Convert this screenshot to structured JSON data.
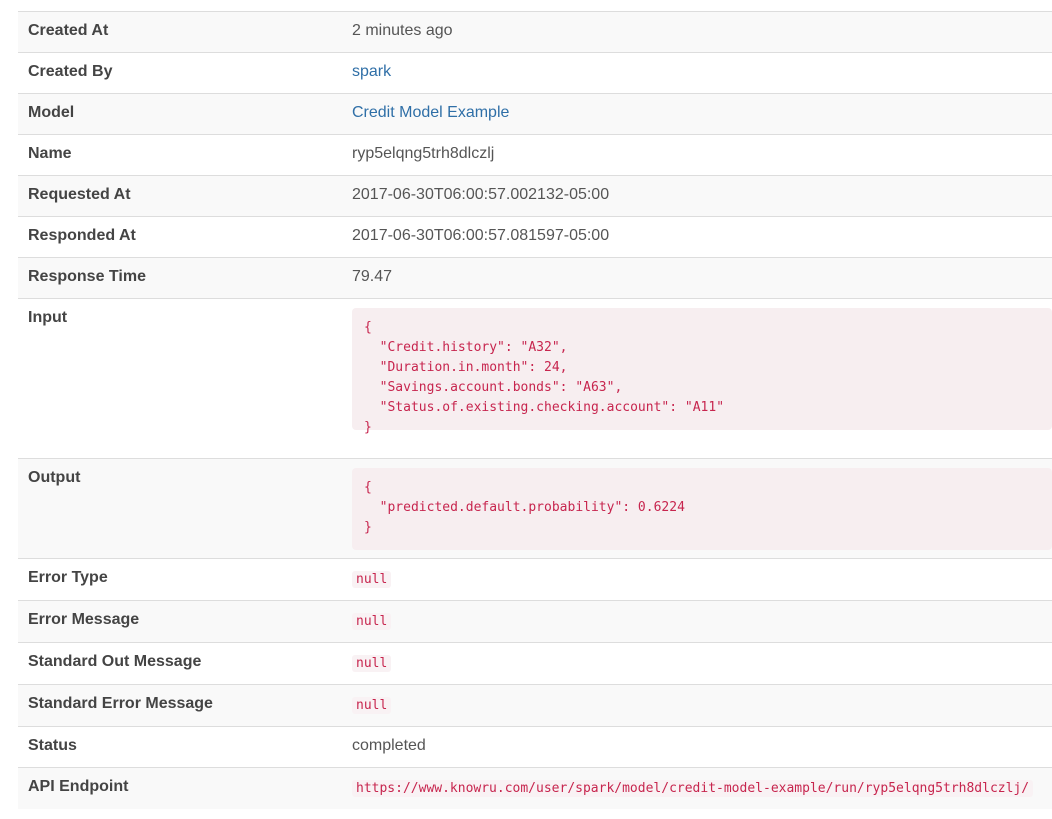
{
  "rows": [
    {
      "label": "Created At",
      "value": "2 minutes ago"
    },
    {
      "label": "Created By",
      "value": "spark"
    },
    {
      "label": "Model",
      "value": "Credit Model Example"
    },
    {
      "label": "Name",
      "value": "ryp5elqng5trh8dlczlj"
    },
    {
      "label": "Requested At",
      "value": "2017-06-30T06:00:57.002132-05:00"
    },
    {
      "label": "Responded At",
      "value": "2017-06-30T06:00:57.081597-05:00"
    },
    {
      "label": "Response Time",
      "value": "79.47"
    },
    {
      "label": "Input",
      "value": "{\n  \"Credit.history\": \"A32\",\n  \"Duration.in.month\": 24,\n  \"Savings.account.bonds\": \"A63\",\n  \"Status.of.existing.checking.account\": \"A11\"\n}"
    },
    {
      "label": "Output",
      "value": "{\n  \"predicted.default.probability\": 0.6224\n}"
    },
    {
      "label": "Error Type",
      "value": "null"
    },
    {
      "label": "Error Message",
      "value": "null"
    },
    {
      "label": "Standard Out Message",
      "value": "null"
    },
    {
      "label": "Standard Error Message",
      "value": "null"
    },
    {
      "label": "Status",
      "value": "completed"
    },
    {
      "label": "API Endpoint",
      "value": "https://www.knowru.com/user/spark/model/credit-model-example/run/ryp5elqng5trh8dlczlj/"
    }
  ],
  "colors": {
    "link": "#2f6fa7",
    "code_text": "#c7254e",
    "code_bg": "#f9f2f4",
    "row_stripe": "#f9f9f9",
    "border": "#dddddd"
  }
}
